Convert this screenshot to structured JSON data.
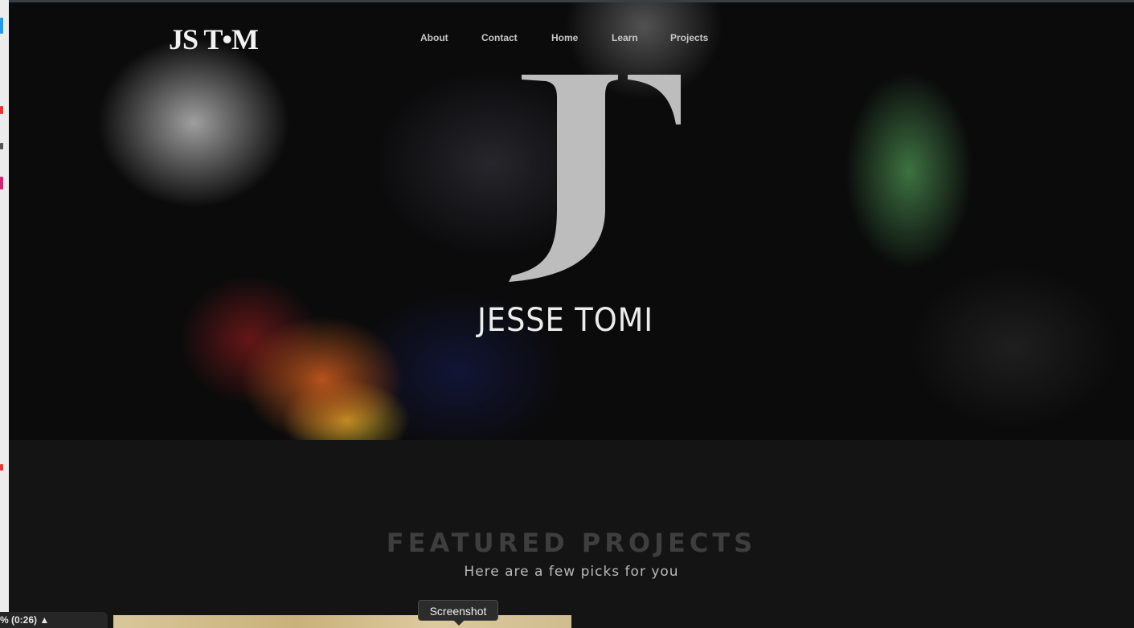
{
  "brand": {
    "logo_text": "JS T•M",
    "name": "JESSE TOMI",
    "monogram": "J"
  },
  "nav": [
    {
      "label": "About"
    },
    {
      "label": "Contact"
    },
    {
      "label": "Home"
    },
    {
      "label": "Learn"
    },
    {
      "label": "Projects"
    }
  ],
  "featured": {
    "title": "FEATURED PROJECTS",
    "subtitle": "Here are a few picks for you"
  },
  "overlay": {
    "tooltip": "Screenshot",
    "status": "% (0:26) ▲"
  },
  "colors": {
    "page_bg": "#141414",
    "hero_bg": "#0b0b0c",
    "logo": "#f2f2f2",
    "monogram": "#bdbdbd",
    "featured_title": "#3e3e3e",
    "featured_subtitle": "#b9b9b9"
  },
  "icons": [
    "dock-app-icon"
  ]
}
